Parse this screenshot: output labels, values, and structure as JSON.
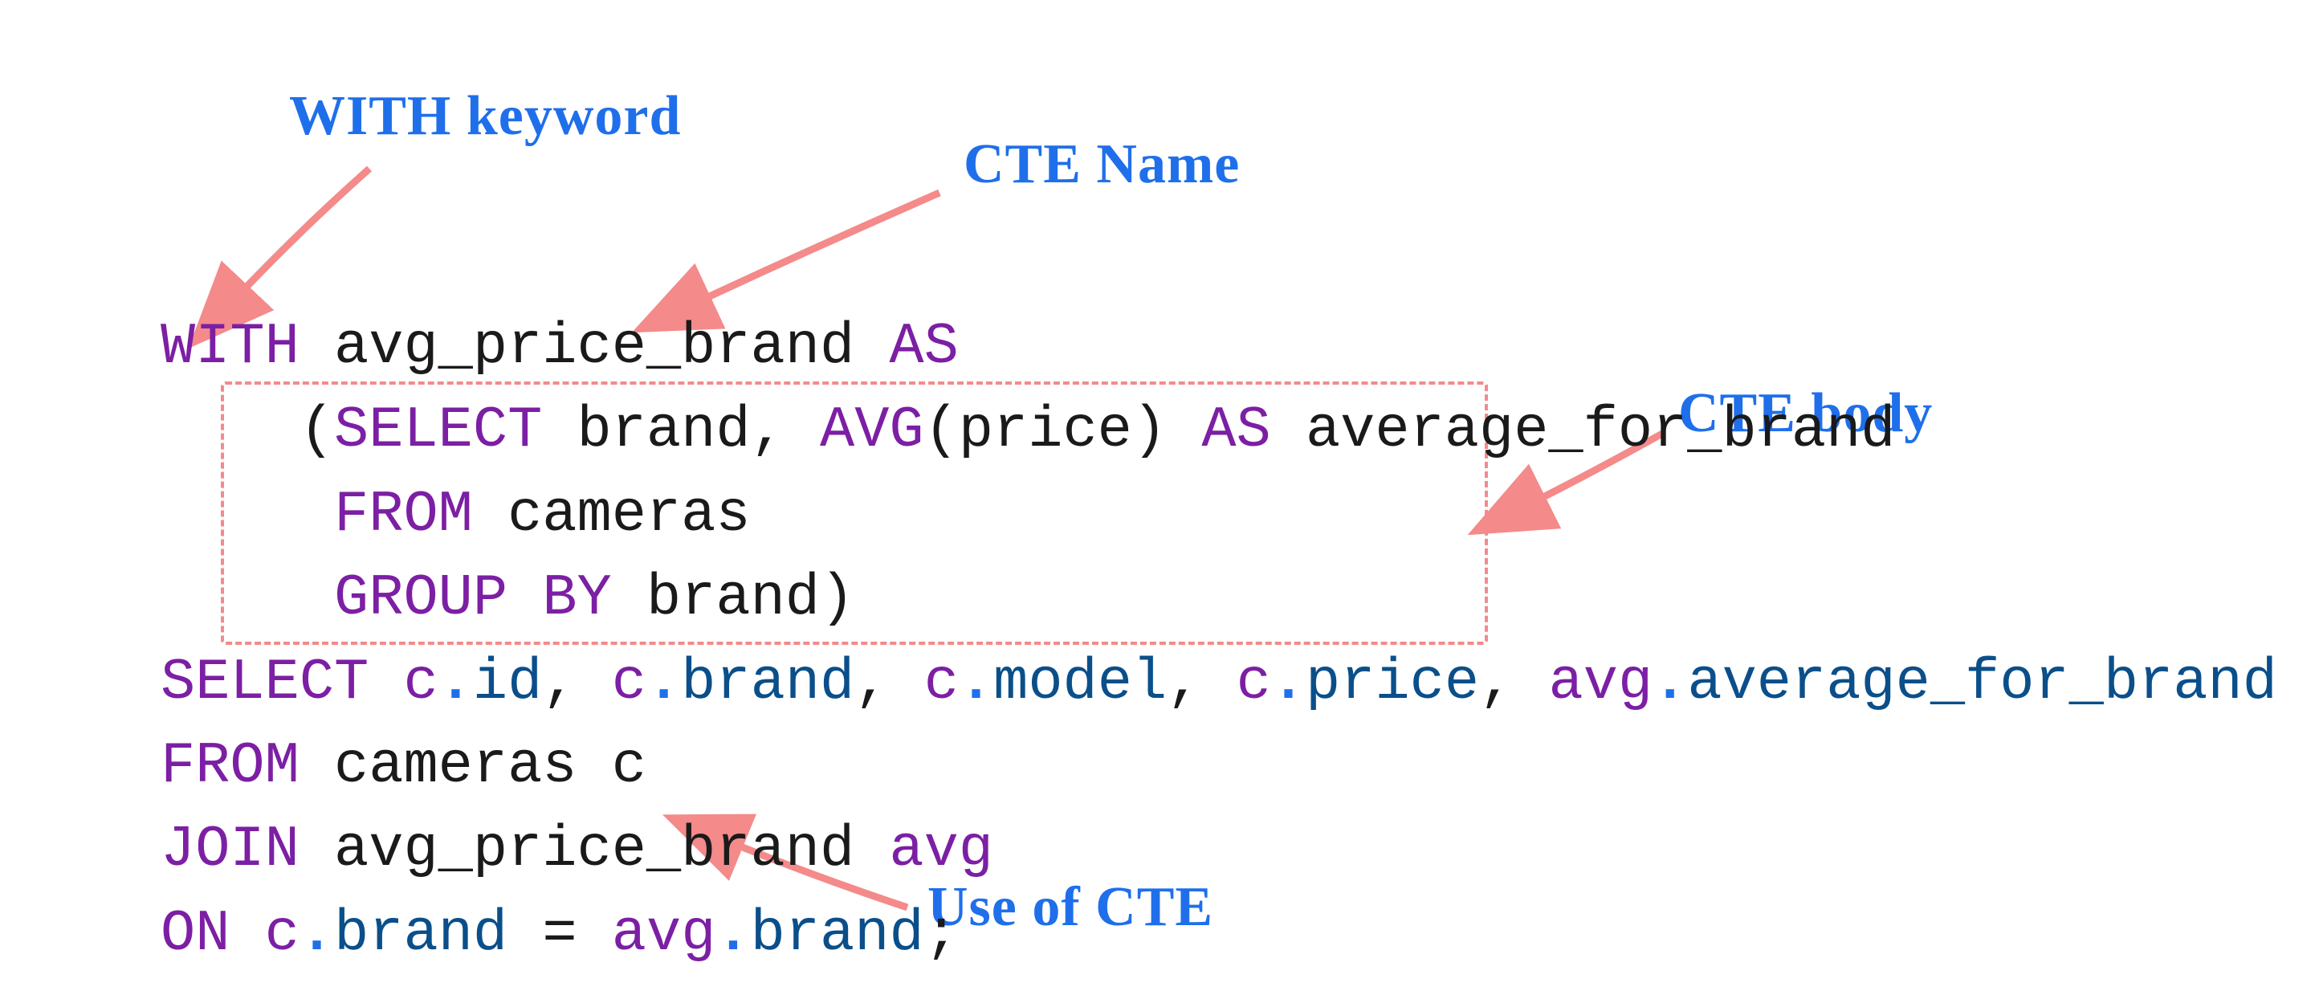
{
  "annotations": {
    "with_keyword": "WITH keyword",
    "cte_name": "CTE Name",
    "cte_body": "CTE body",
    "use_of_cte": "Use of CTE"
  },
  "code": {
    "line1": {
      "with": "WITH",
      "name": "avg_price_brand",
      "as": "AS"
    },
    "line2": {
      "indent": "    ",
      "lp": "(",
      "select": "SELECT",
      "brand": "brand",
      "comma1": ",",
      "avg": "AVG",
      "lp2": "(",
      "price": "price",
      "rp2": ")",
      "as": "AS",
      "alias": "average_for_brand"
    },
    "line3": {
      "indent": "     ",
      "from": "FROM",
      "table": "cameras"
    },
    "line4": {
      "indent": "     ",
      "group": "GROUP",
      "by": "BY",
      "col": "brand",
      "rp": ")"
    },
    "line5": {
      "select": "SELECT",
      "c1q": "c",
      "c1c": "id",
      "c2q": "c",
      "c2c": "brand",
      "c3q": "c",
      "c3c": "model",
      "c4q": "c",
      "c4c": "price",
      "c5q": "avg",
      "c5c": "average_for_brand"
    },
    "line6": {
      "from": "FROM",
      "t": "cameras",
      "a": "c"
    },
    "line7": {
      "join": "JOIN",
      "t": "avg_price_brand",
      "a": "avg"
    },
    "line8": {
      "on": "ON",
      "lq": "c",
      "lc": "brand",
      "eq": "=",
      "rq": "avg",
      "rc": "brand",
      "semi": ";"
    }
  },
  "colors": {
    "annotation": "#1f6feb",
    "arrow": "#f48a8a",
    "keyword": "#7c1fa4",
    "column": "#0a4f8a"
  }
}
